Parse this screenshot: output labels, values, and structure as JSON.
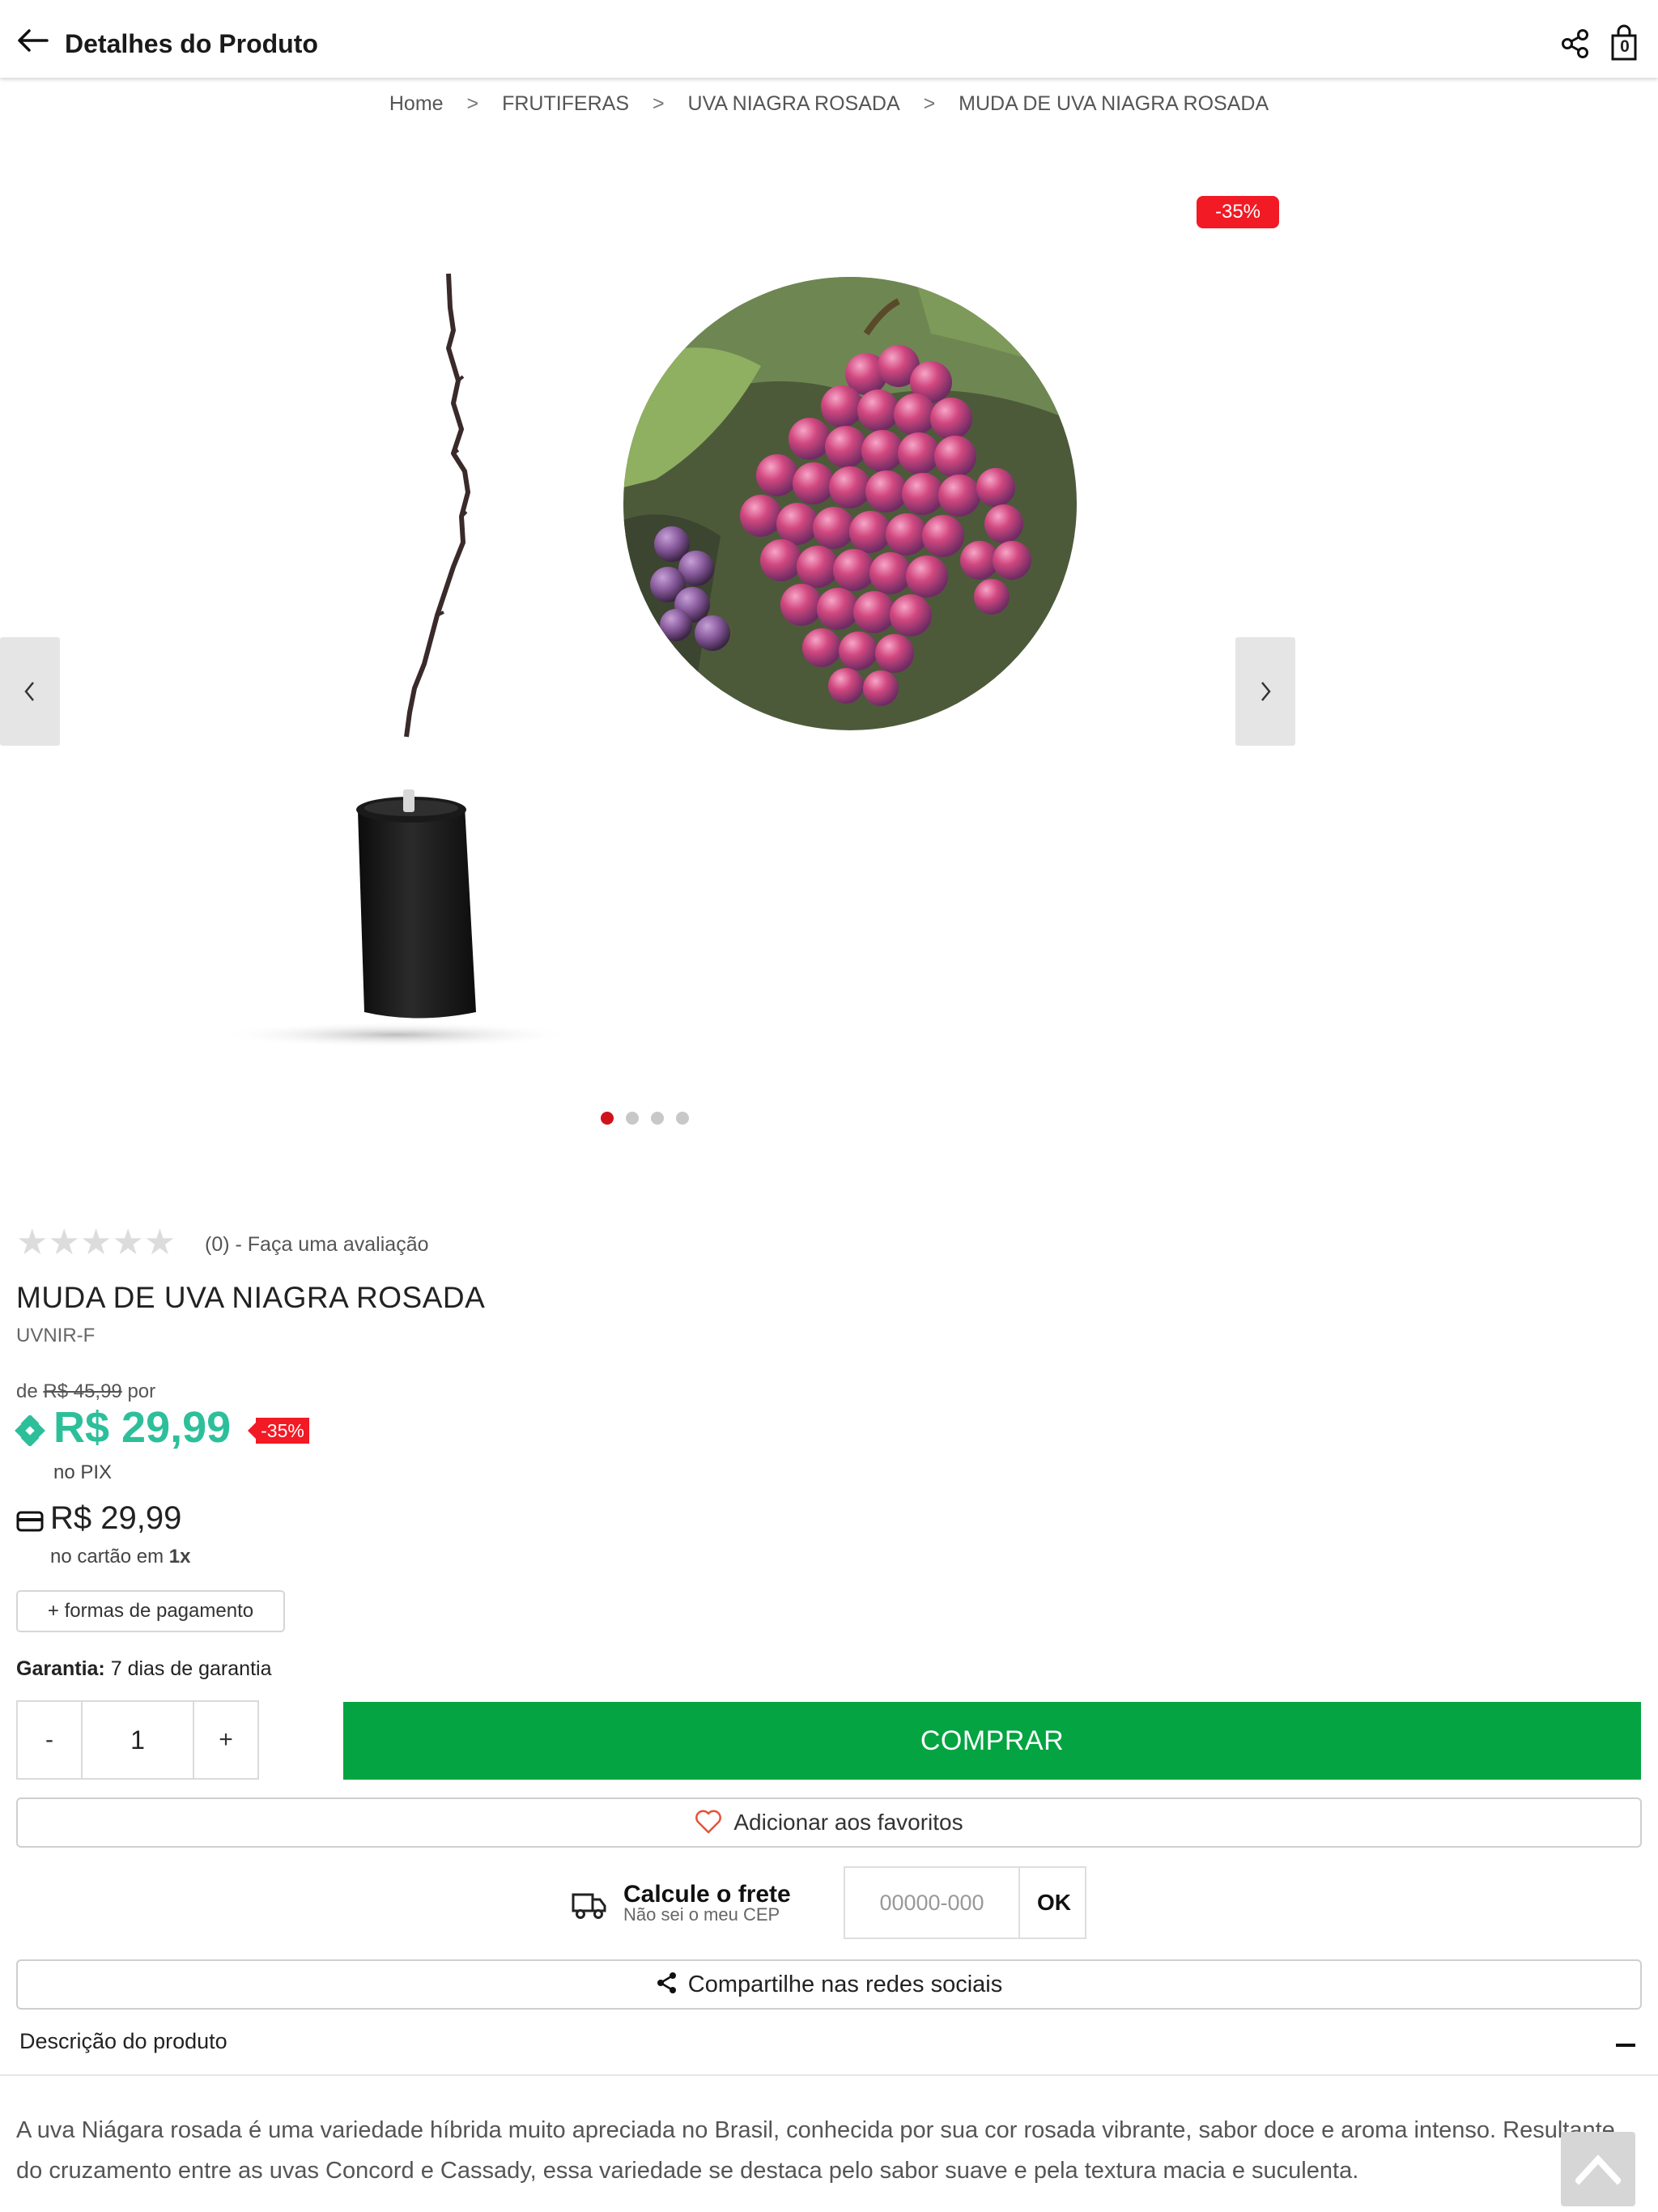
{
  "header": {
    "title": "Detalhes do Produto",
    "cart_count": "0",
    "icons": [
      "back-arrow-icon",
      "share-icon",
      "shopping-bag-icon"
    ]
  },
  "breadcrumb": {
    "items": [
      "Home",
      "FRUTIFERAS",
      "UVA NIAGRA ROSADA",
      "MUDA DE UVA NIAGRA ROSADA"
    ],
    "separator": ">"
  },
  "gallery": {
    "discount_badge": "-35%",
    "image_count": 4,
    "active_index": 0
  },
  "rating": {
    "stars": 0,
    "max_stars": 5,
    "text": "(0) - Faça uma avaliação"
  },
  "product": {
    "name": "MUDA DE UVA NIAGRA ROSADA",
    "sku": "UVNIR-F"
  },
  "price": {
    "old_prefix": "de",
    "old_value": "R$ 45,99",
    "old_suffix": "por",
    "pix_value": "R$ 29,99",
    "pix_discount": "-35%",
    "pix_label": "no PIX",
    "card_value": "R$ 29,99",
    "card_label": "no cartão em",
    "card_installments": "1x",
    "payment_button": "+ formas de pagamento"
  },
  "warranty": {
    "label": "Garantia:",
    "value": "7 dias de garantia"
  },
  "purchase": {
    "minus": "-",
    "quantity": "1",
    "plus": "+",
    "buy_label": "COMPRAR",
    "favorite_label": "Adicionar aos favoritos"
  },
  "freight": {
    "title": "Calcule o frete",
    "subtitle": "Não sei o meu CEP",
    "placeholder": "00000-000",
    "ok_label": "OK"
  },
  "social": {
    "label": "Compartilhe nas redes sociais"
  },
  "description": {
    "header": "Descrição do produto",
    "text": "A uva Niágara rosada é uma variedade híbrida muito apreciada no Brasil, conhecida por sua cor rosada vibrante, sabor doce e aroma intenso. Resultante do cruzamento entre as uvas Concord e Cassady, essa variedade se destaca pelo sabor suave e pela textura macia e suculenta."
  },
  "colors": {
    "buy_button": "#03a441",
    "pix_price": "#2dbf9a",
    "discount": "#f21a24",
    "active_dot": "#d0121b"
  }
}
